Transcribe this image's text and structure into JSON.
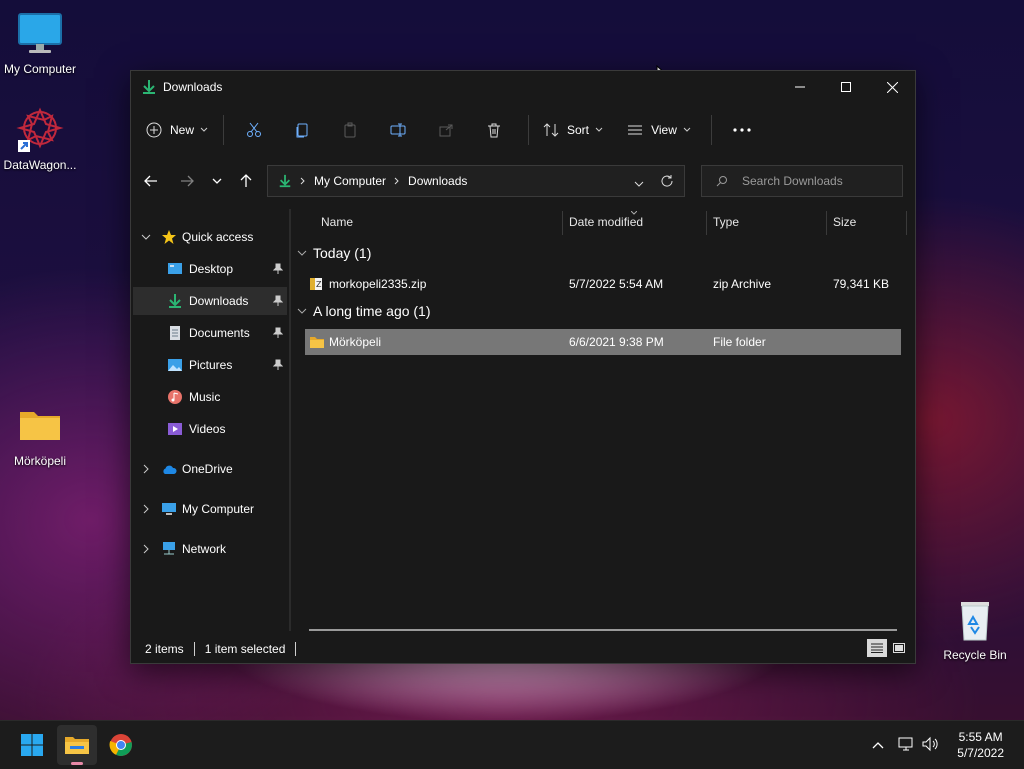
{
  "desktop": {
    "icons": [
      {
        "label": "My Computer"
      },
      {
        "label": "DataWagon..."
      },
      {
        "label": "Mörköpeli"
      },
      {
        "label": "Recycle Bin"
      }
    ]
  },
  "window": {
    "title": "Downloads",
    "toolbar": {
      "new_label": "New",
      "sort_label": "Sort",
      "view_label": "View"
    },
    "address": {
      "crumbs": [
        "My Computer",
        "Downloads"
      ]
    },
    "search": {
      "placeholder": "Search Downloads"
    },
    "nav": {
      "quick_access": "Quick access",
      "items": [
        {
          "label": "Desktop",
          "pinned": true
        },
        {
          "label": "Downloads",
          "pinned": true,
          "selected": true
        },
        {
          "label": "Documents",
          "pinned": true
        },
        {
          "label": "Pictures",
          "pinned": true
        },
        {
          "label": "Music",
          "pinned": false
        },
        {
          "label": "Videos",
          "pinned": false
        }
      ],
      "onedrive": "OneDrive",
      "mycomputer": "My Computer",
      "network": "Network"
    },
    "columns": {
      "name": "Name",
      "date": "Date modified",
      "type": "Type",
      "size": "Size"
    },
    "groups": [
      {
        "label": "Today (1)",
        "rows": [
          {
            "name": "morkopeli2335.zip",
            "date": "5/7/2022 5:54 AM",
            "type": "zip Archive",
            "size": "79,341 KB"
          }
        ]
      },
      {
        "label": "A long time ago (1)",
        "rows": [
          {
            "name": "Mörköpeli",
            "date": "6/6/2021 9:38 PM",
            "type": "File folder",
            "size": ""
          }
        ]
      }
    ],
    "status": {
      "items": "2 items",
      "selected": "1 item selected"
    }
  },
  "taskbar": {
    "time": "5:55 AM",
    "date": "5/7/2022"
  },
  "colors": {
    "accent_download": "#2bb673",
    "folder": "#f6c445",
    "selection": "#777777"
  }
}
